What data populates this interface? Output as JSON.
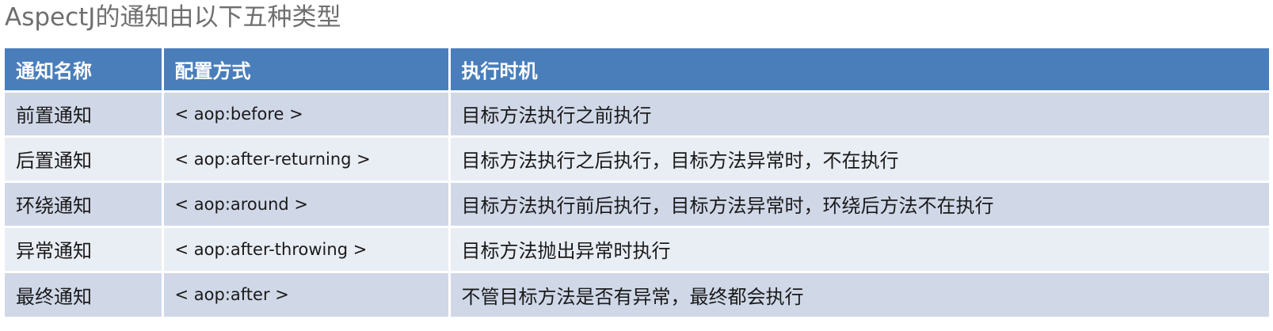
{
  "title": "AspectJ的通知由以下五种类型",
  "table": {
    "headers": [
      "通知名称",
      "配置方式",
      "执行时机"
    ],
    "rows": [
      {
        "name": "前置通知",
        "config": "< aop:before >",
        "timing": "目标方法执行之前执行"
      },
      {
        "name": "后置通知",
        "config": "< aop:after-returning >",
        "timing": "目标方法执行之后执行，目标方法异常时，不在执行"
      },
      {
        "name": "环绕通知",
        "config": "< aop:around >",
        "timing": "目标方法执行前后执行，目标方法异常时，环绕后方法不在执行"
      },
      {
        "name": "异常通知",
        "config": "< aop:after-throwing >",
        "timing": "目标方法抛出异常时执行"
      },
      {
        "name": "最终通知",
        "config": "< aop:after >",
        "timing": "不管目标方法是否有异常，最终都会执行"
      }
    ]
  },
  "colors": {
    "header_bg": "#4a7ebb",
    "row_odd_bg": "#d0d8e8",
    "row_even_bg": "#e9edf4",
    "title_text": "#6f6f6f"
  }
}
